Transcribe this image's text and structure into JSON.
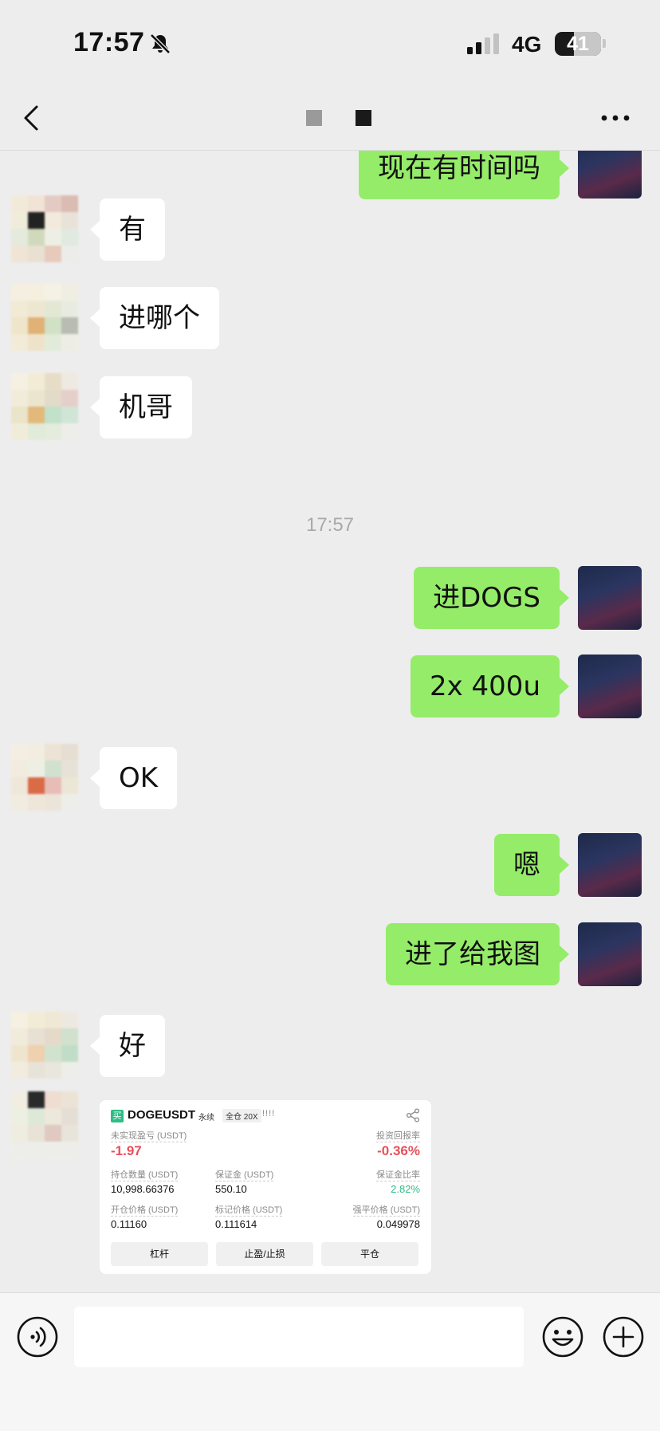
{
  "status_bar": {
    "time": "17:57",
    "network": "4G",
    "battery": "41",
    "battery_level": 0.41
  },
  "nav": {
    "back_icon": "chevron-left-icon",
    "more_icon": "ellipsis-icon"
  },
  "messages": [
    {
      "direction": "out",
      "text": "现在有时间吗"
    },
    {
      "direction": "in",
      "text": "有"
    },
    {
      "direction": "in",
      "text": "进哪个"
    },
    {
      "direction": "in",
      "text": "机哥"
    },
    {
      "type": "timestamp",
      "text": "17:57"
    },
    {
      "direction": "out",
      "text": "进DOGS"
    },
    {
      "direction": "out",
      "text": "2x 400u"
    },
    {
      "direction": "in",
      "text": "OK"
    },
    {
      "direction": "out",
      "text": "嗯"
    },
    {
      "direction": "out",
      "text": "进了给我图"
    },
    {
      "direction": "in",
      "text": "好"
    }
  ],
  "trade_card": {
    "buy_badge": "买",
    "symbol": "DOGEUSDT",
    "tag_perpetual": "永续",
    "tag_margin": "全仓 20X",
    "tag_bars": "!!!!",
    "unrealized_pnl_label": "未实现盈亏 (USDT)",
    "unrealized_pnl_value": "-1.97",
    "roi_label": "投资回报率",
    "roi_value": "-0.36%",
    "position_label": "持仓数量 (USDT)",
    "position_value": "10,998.66376",
    "margin_label": "保证金 (USDT)",
    "margin_value": "550.10",
    "margin_ratio_label": "保证金比率",
    "margin_ratio_value": "2.82%",
    "entry_price_label": "开仓价格 (USDT)",
    "entry_price_value": "0.11160",
    "mark_price_label": "标记价格 (USDT)",
    "mark_price_value": "0.111614",
    "liq_price_label": "强平价格 (USDT)",
    "liq_price_value": "0.049978",
    "btn_leverage": "杠杆",
    "btn_tpsl": "止盈/止损",
    "btn_close": "平仓"
  },
  "input_bar": {
    "voice_icon": "voice-icon",
    "emoji_icon": "emoji-icon",
    "plus_icon": "plus-icon"
  },
  "colors": {
    "outgoing_bubble": "#95ec69",
    "incoming_bubble": "#ffffff",
    "background": "#ededed",
    "loss_red": "#e8505b",
    "gain_green": "#2ebd85"
  }
}
